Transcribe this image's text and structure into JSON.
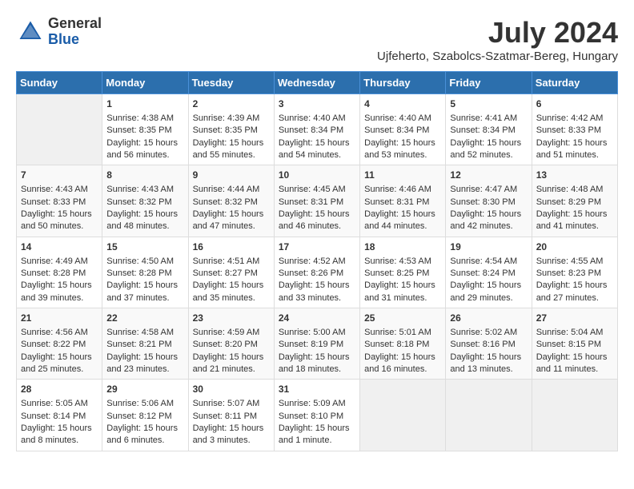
{
  "header": {
    "logo": {
      "general": "General",
      "blue": "Blue"
    },
    "month": "July 2024",
    "location": "Ujfeherto, Szabolcs-Szatmar-Bereg, Hungary"
  },
  "days_of_week": [
    "Sunday",
    "Monday",
    "Tuesday",
    "Wednesday",
    "Thursday",
    "Friday",
    "Saturday"
  ],
  "weeks": [
    {
      "days": [
        {
          "num": "",
          "info": ""
        },
        {
          "num": "1",
          "info": "Sunrise: 4:38 AM\nSunset: 8:35 PM\nDaylight: 15 hours\nand 56 minutes."
        },
        {
          "num": "2",
          "info": "Sunrise: 4:39 AM\nSunset: 8:35 PM\nDaylight: 15 hours\nand 55 minutes."
        },
        {
          "num": "3",
          "info": "Sunrise: 4:40 AM\nSunset: 8:34 PM\nDaylight: 15 hours\nand 54 minutes."
        },
        {
          "num": "4",
          "info": "Sunrise: 4:40 AM\nSunset: 8:34 PM\nDaylight: 15 hours\nand 53 minutes."
        },
        {
          "num": "5",
          "info": "Sunrise: 4:41 AM\nSunset: 8:34 PM\nDaylight: 15 hours\nand 52 minutes."
        },
        {
          "num": "6",
          "info": "Sunrise: 4:42 AM\nSunset: 8:33 PM\nDaylight: 15 hours\nand 51 minutes."
        }
      ]
    },
    {
      "days": [
        {
          "num": "7",
          "info": "Sunrise: 4:43 AM\nSunset: 8:33 PM\nDaylight: 15 hours\nand 50 minutes."
        },
        {
          "num": "8",
          "info": "Sunrise: 4:43 AM\nSunset: 8:32 PM\nDaylight: 15 hours\nand 48 minutes."
        },
        {
          "num": "9",
          "info": "Sunrise: 4:44 AM\nSunset: 8:32 PM\nDaylight: 15 hours\nand 47 minutes."
        },
        {
          "num": "10",
          "info": "Sunrise: 4:45 AM\nSunset: 8:31 PM\nDaylight: 15 hours\nand 46 minutes."
        },
        {
          "num": "11",
          "info": "Sunrise: 4:46 AM\nSunset: 8:31 PM\nDaylight: 15 hours\nand 44 minutes."
        },
        {
          "num": "12",
          "info": "Sunrise: 4:47 AM\nSunset: 8:30 PM\nDaylight: 15 hours\nand 42 minutes."
        },
        {
          "num": "13",
          "info": "Sunrise: 4:48 AM\nSunset: 8:29 PM\nDaylight: 15 hours\nand 41 minutes."
        }
      ]
    },
    {
      "days": [
        {
          "num": "14",
          "info": "Sunrise: 4:49 AM\nSunset: 8:28 PM\nDaylight: 15 hours\nand 39 minutes."
        },
        {
          "num": "15",
          "info": "Sunrise: 4:50 AM\nSunset: 8:28 PM\nDaylight: 15 hours\nand 37 minutes."
        },
        {
          "num": "16",
          "info": "Sunrise: 4:51 AM\nSunset: 8:27 PM\nDaylight: 15 hours\nand 35 minutes."
        },
        {
          "num": "17",
          "info": "Sunrise: 4:52 AM\nSunset: 8:26 PM\nDaylight: 15 hours\nand 33 minutes."
        },
        {
          "num": "18",
          "info": "Sunrise: 4:53 AM\nSunset: 8:25 PM\nDaylight: 15 hours\nand 31 minutes."
        },
        {
          "num": "19",
          "info": "Sunrise: 4:54 AM\nSunset: 8:24 PM\nDaylight: 15 hours\nand 29 minutes."
        },
        {
          "num": "20",
          "info": "Sunrise: 4:55 AM\nSunset: 8:23 PM\nDaylight: 15 hours\nand 27 minutes."
        }
      ]
    },
    {
      "days": [
        {
          "num": "21",
          "info": "Sunrise: 4:56 AM\nSunset: 8:22 PM\nDaylight: 15 hours\nand 25 minutes."
        },
        {
          "num": "22",
          "info": "Sunrise: 4:58 AM\nSunset: 8:21 PM\nDaylight: 15 hours\nand 23 minutes."
        },
        {
          "num": "23",
          "info": "Sunrise: 4:59 AM\nSunset: 8:20 PM\nDaylight: 15 hours\nand 21 minutes."
        },
        {
          "num": "24",
          "info": "Sunrise: 5:00 AM\nSunset: 8:19 PM\nDaylight: 15 hours\nand 18 minutes."
        },
        {
          "num": "25",
          "info": "Sunrise: 5:01 AM\nSunset: 8:18 PM\nDaylight: 15 hours\nand 16 minutes."
        },
        {
          "num": "26",
          "info": "Sunrise: 5:02 AM\nSunset: 8:16 PM\nDaylight: 15 hours\nand 13 minutes."
        },
        {
          "num": "27",
          "info": "Sunrise: 5:04 AM\nSunset: 8:15 PM\nDaylight: 15 hours\nand 11 minutes."
        }
      ]
    },
    {
      "days": [
        {
          "num": "28",
          "info": "Sunrise: 5:05 AM\nSunset: 8:14 PM\nDaylight: 15 hours\nand 8 minutes."
        },
        {
          "num": "29",
          "info": "Sunrise: 5:06 AM\nSunset: 8:12 PM\nDaylight: 15 hours\nand 6 minutes."
        },
        {
          "num": "30",
          "info": "Sunrise: 5:07 AM\nSunset: 8:11 PM\nDaylight: 15 hours\nand 3 minutes."
        },
        {
          "num": "31",
          "info": "Sunrise: 5:09 AM\nSunset: 8:10 PM\nDaylight: 15 hours\nand 1 minute."
        },
        {
          "num": "",
          "info": ""
        },
        {
          "num": "",
          "info": ""
        },
        {
          "num": "",
          "info": ""
        }
      ]
    }
  ]
}
